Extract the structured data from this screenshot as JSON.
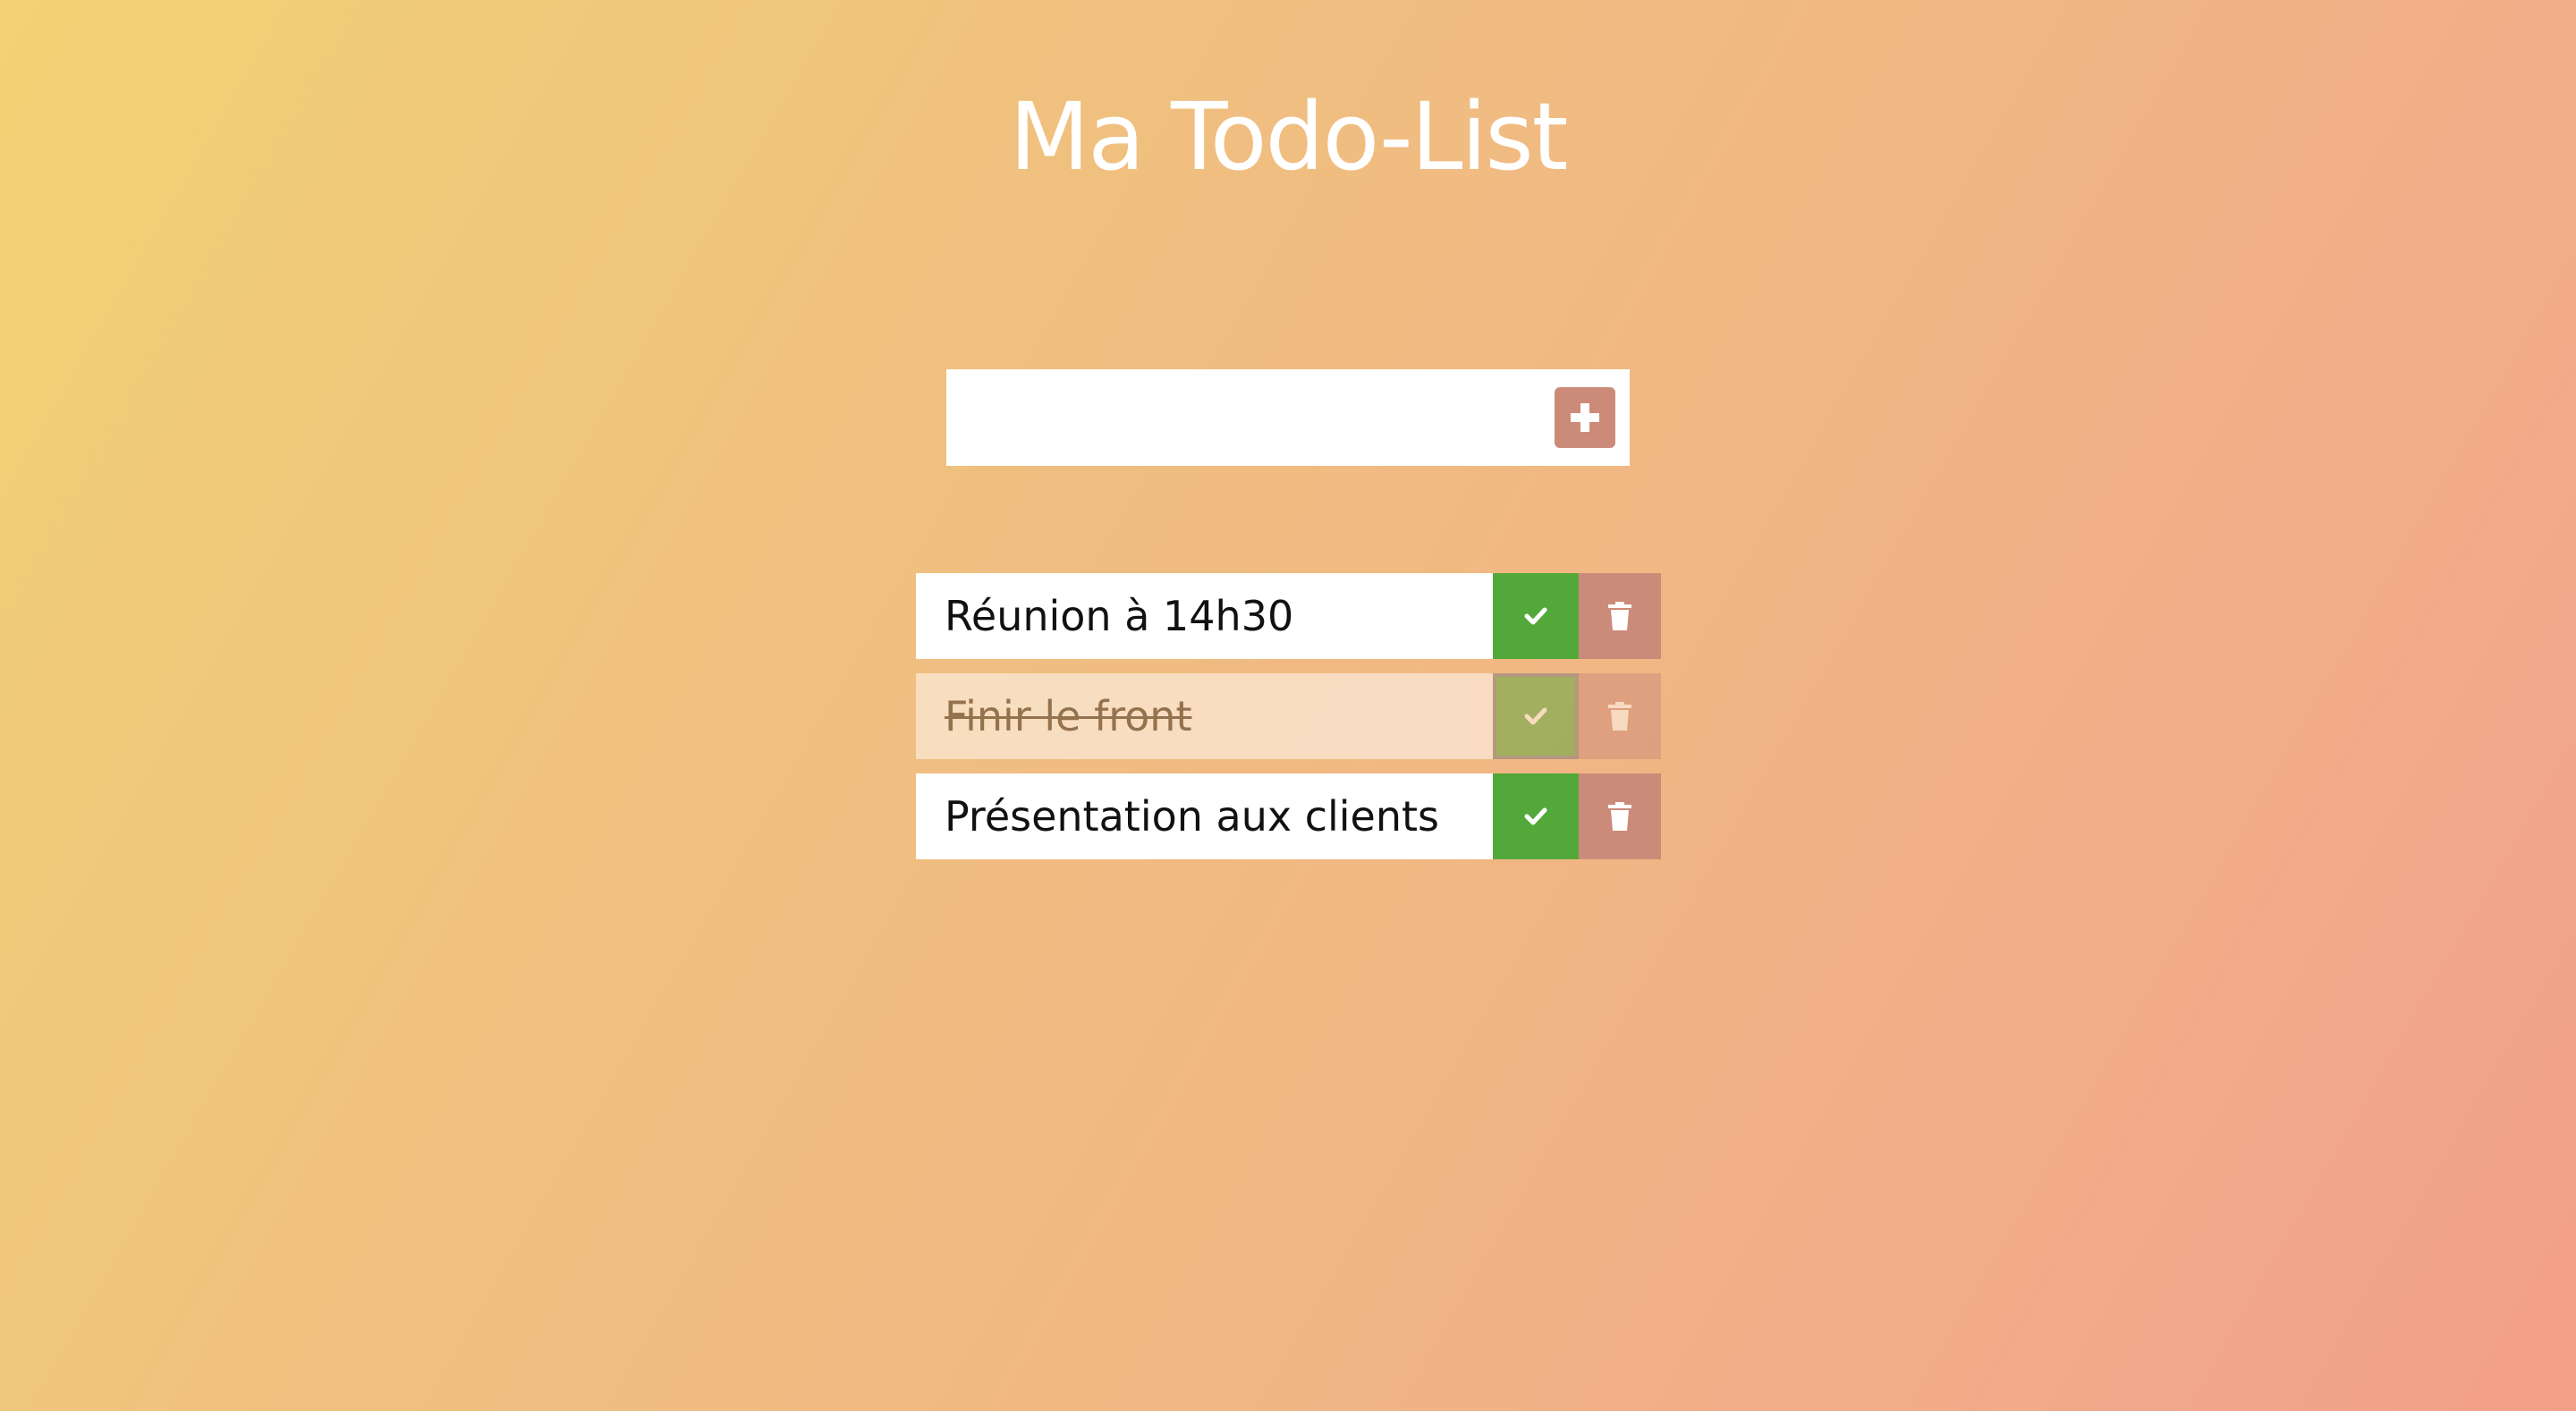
{
  "header": {
    "title": "Ma Todo-List"
  },
  "form": {
    "input_value": "",
    "input_placeholder": "",
    "add_icon": "plus-square-icon"
  },
  "todos": [
    {
      "text": "Réunion à 14h30",
      "completed": false
    },
    {
      "text": "Finir le front",
      "completed": true
    },
    {
      "text": "Présentation aux clients",
      "completed": false
    }
  ],
  "icons": {
    "complete": "check-icon",
    "delete": "trash-icon"
  },
  "colors": {
    "check": "#53a83a",
    "trash": "#cc8b79",
    "add": "#cc8b79",
    "title": "#ffffff"
  }
}
